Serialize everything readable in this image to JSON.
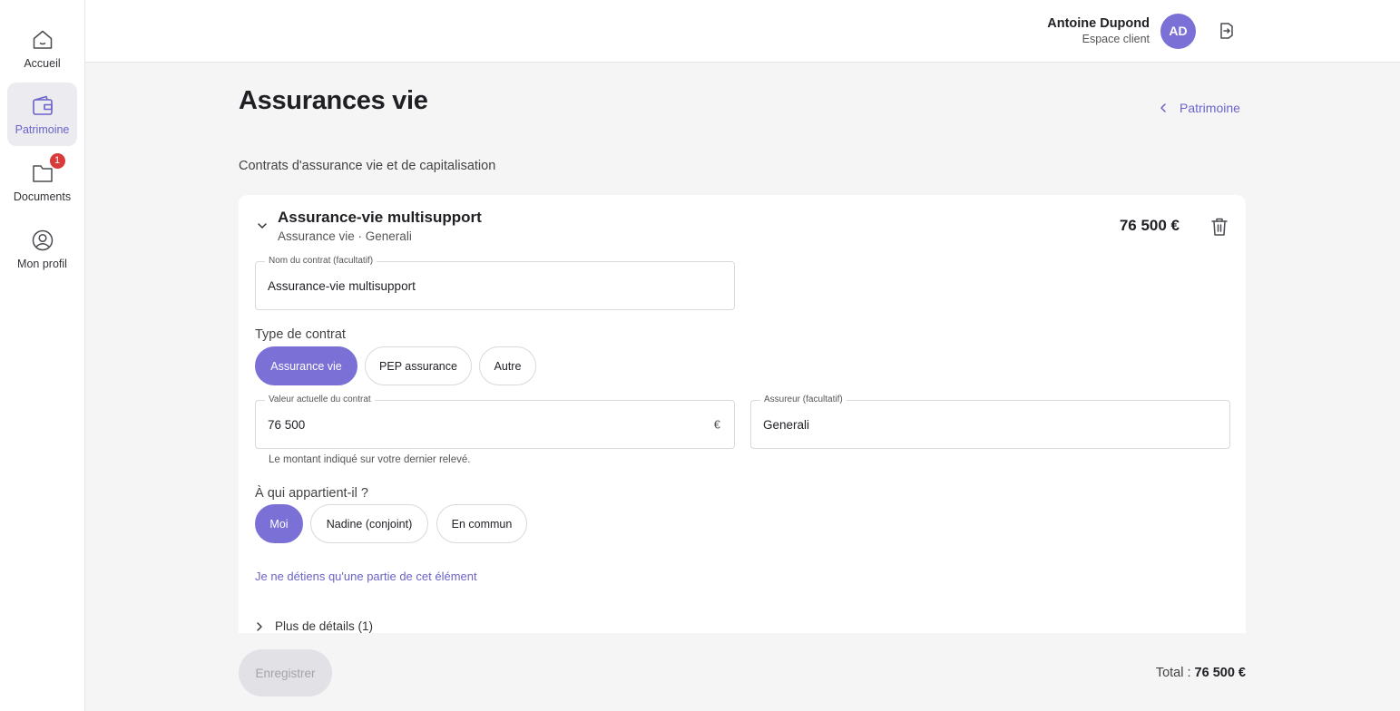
{
  "sidebar": {
    "items": [
      {
        "label": "Accueil",
        "icon": "home-icon"
      },
      {
        "label": "Patrimoine",
        "icon": "wallet-icon",
        "active": true
      },
      {
        "label": "Documents",
        "icon": "folder-icon",
        "badge": "1"
      },
      {
        "label": "Mon profil",
        "icon": "user-icon"
      }
    ]
  },
  "header": {
    "user_name": "Antoine Dupond",
    "user_role": "Espace client",
    "avatar_initials": "AD"
  },
  "page": {
    "title": "Assurances vie",
    "back_label": "Patrimoine",
    "subtitle": "Contrats d'assurance vie et de capitalisation"
  },
  "card": {
    "title": "Assurance-vie multisupport",
    "subtitle": "Assurance vie · Generali",
    "amount": "76 500 €",
    "contract_name_label": "Nom du contrat (facultatif)",
    "contract_name_value": "Assurance-vie multisupport",
    "contract_type_label": "Type de contrat",
    "contract_types": [
      "Assurance vie",
      "PEP assurance",
      "Autre"
    ],
    "contract_type_selected": "Assurance vie",
    "value_label": "Valeur actuelle du contrat",
    "value_value": "76 500",
    "value_suffix": "€",
    "value_help": "Le montant indiqué sur votre dernier relevé.",
    "insurer_label": "Assureur (facultatif)",
    "insurer_value": "Generali",
    "owner_label": "À qui appartient-il ?",
    "owners": [
      "Moi",
      "Nadine (conjoint)",
      "En commun"
    ],
    "owner_selected": "Moi",
    "partial_link": "Je ne détiens qu'une partie de cet élément",
    "more_details": "Plus de détails (1)"
  },
  "footer": {
    "save_label": "Enregistrer",
    "total_label": "Total :",
    "total_value": "76 500 €"
  },
  "colors": {
    "accent": "#7a70d6",
    "link": "#6b63c9",
    "badge": "#d93a3a"
  }
}
